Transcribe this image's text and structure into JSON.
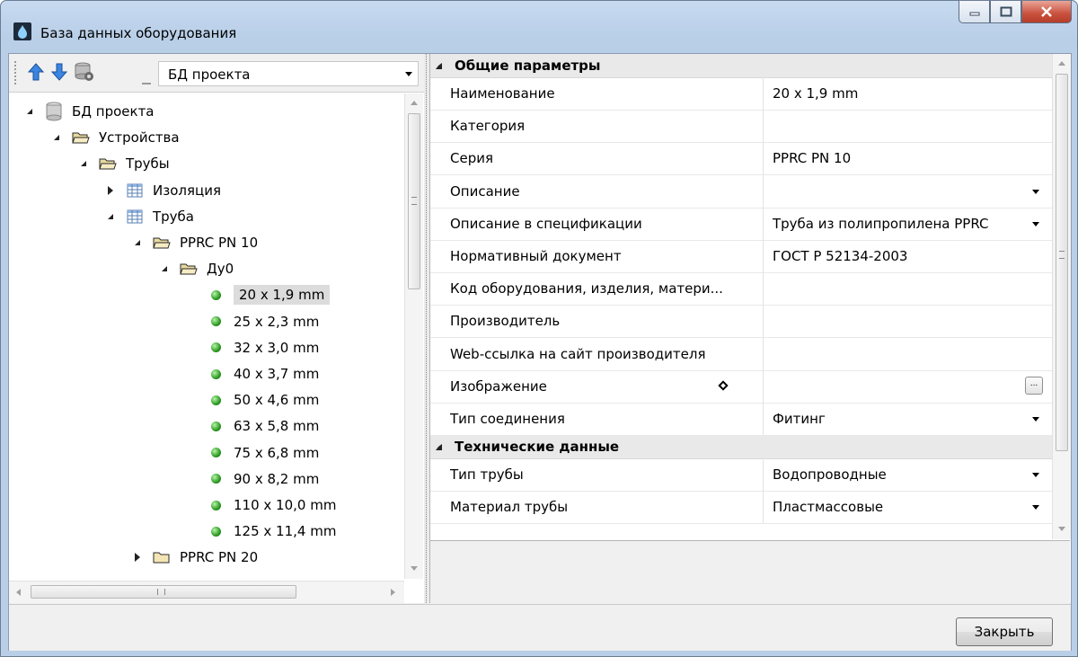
{
  "window": {
    "title": "База данных оборудования"
  },
  "toolbar": {
    "db_select_value": "БД проекта"
  },
  "tree": {
    "nodes": [
      {
        "label": "БД проекта",
        "level": 0,
        "icon": "database-icon",
        "expander": "open"
      },
      {
        "label": "Устройства",
        "level": 1,
        "icon": "folder-open-icon",
        "expander": "open"
      },
      {
        "label": "Трубы",
        "level": 2,
        "icon": "folder-open-icon",
        "expander": "open"
      },
      {
        "label": "Изоляция",
        "level": 3,
        "icon": "table-icon",
        "expander": "closed"
      },
      {
        "label": "Труба",
        "level": 3,
        "icon": "table-icon",
        "expander": "open"
      },
      {
        "label": "PPRC PN 10",
        "level": 4,
        "icon": "folder-open-icon",
        "expander": "open"
      },
      {
        "label": "Ду0",
        "level": 5,
        "icon": "folder-open-icon",
        "expander": "open"
      },
      {
        "label": "20 x 1,9 mm",
        "level": 6,
        "icon": "green-ball-icon",
        "expander": "none",
        "selected": true
      },
      {
        "label": "25 x 2,3 mm",
        "level": 6,
        "icon": "green-ball-icon",
        "expander": "none"
      },
      {
        "label": "32 x 3,0 mm",
        "level": 6,
        "icon": "green-ball-icon",
        "expander": "none"
      },
      {
        "label": "40 x 3,7 mm",
        "level": 6,
        "icon": "green-ball-icon",
        "expander": "none"
      },
      {
        "label": "50 x 4,6 mm",
        "level": 6,
        "icon": "green-ball-icon",
        "expander": "none"
      },
      {
        "label": "63 x 5,8 mm",
        "level": 6,
        "icon": "green-ball-icon",
        "expander": "none"
      },
      {
        "label": "75 x 6,8 mm",
        "level": 6,
        "icon": "green-ball-icon",
        "expander": "none"
      },
      {
        "label": "90 x 8,2 mm",
        "level": 6,
        "icon": "green-ball-icon",
        "expander": "none"
      },
      {
        "label": "110 x 10,0 mm",
        "level": 6,
        "icon": "green-ball-icon",
        "expander": "none"
      },
      {
        "label": "125 x 11,4 mm",
        "level": 6,
        "icon": "green-ball-icon",
        "expander": "none"
      },
      {
        "label": "PPRC PN 20",
        "level": 4,
        "icon": "folder-closed-icon",
        "expander": "closed"
      }
    ]
  },
  "properties": {
    "general": {
      "title": "Общие параметры",
      "rows": [
        {
          "name": "Наименование",
          "value": "20 x 1,9 mm"
        },
        {
          "name": "Категория",
          "value": ""
        },
        {
          "name": "Серия",
          "value": "PPRC PN 10"
        },
        {
          "name": "Описание",
          "value": "",
          "dropdown": true
        },
        {
          "name": "Описание в спецификации",
          "value": "Труба из полипропилена PPRC",
          "dropdown": true
        },
        {
          "name": "Нормативный документ",
          "value": "ГОСТ Р 52134-2003"
        },
        {
          "name": "Код оборудования, изделия, матери...",
          "value": ""
        },
        {
          "name": "Производитель",
          "value": ""
        },
        {
          "name": "Web-ссылка на сайт производителя",
          "value": ""
        },
        {
          "name": "Изображение",
          "value": "",
          "ellipsis": true,
          "ellipsis_label": "...",
          "marker": true
        },
        {
          "name": "Тип соединения",
          "value": "Фитинг",
          "dropdown": true
        }
      ]
    },
    "technical": {
      "title": "Технические данные",
      "rows": [
        {
          "name": "Тип трубы",
          "value": "Водопроводные",
          "dropdown": true
        },
        {
          "name": "Материал трубы",
          "value": "Пластмассовые",
          "dropdown": true
        }
      ]
    }
  },
  "footer": {
    "close_label": "Закрыть"
  },
  "colors": {
    "selection": "#dcdcdc",
    "category_bg": "#e9e9e9",
    "window_frame": "#b9cfe8"
  }
}
